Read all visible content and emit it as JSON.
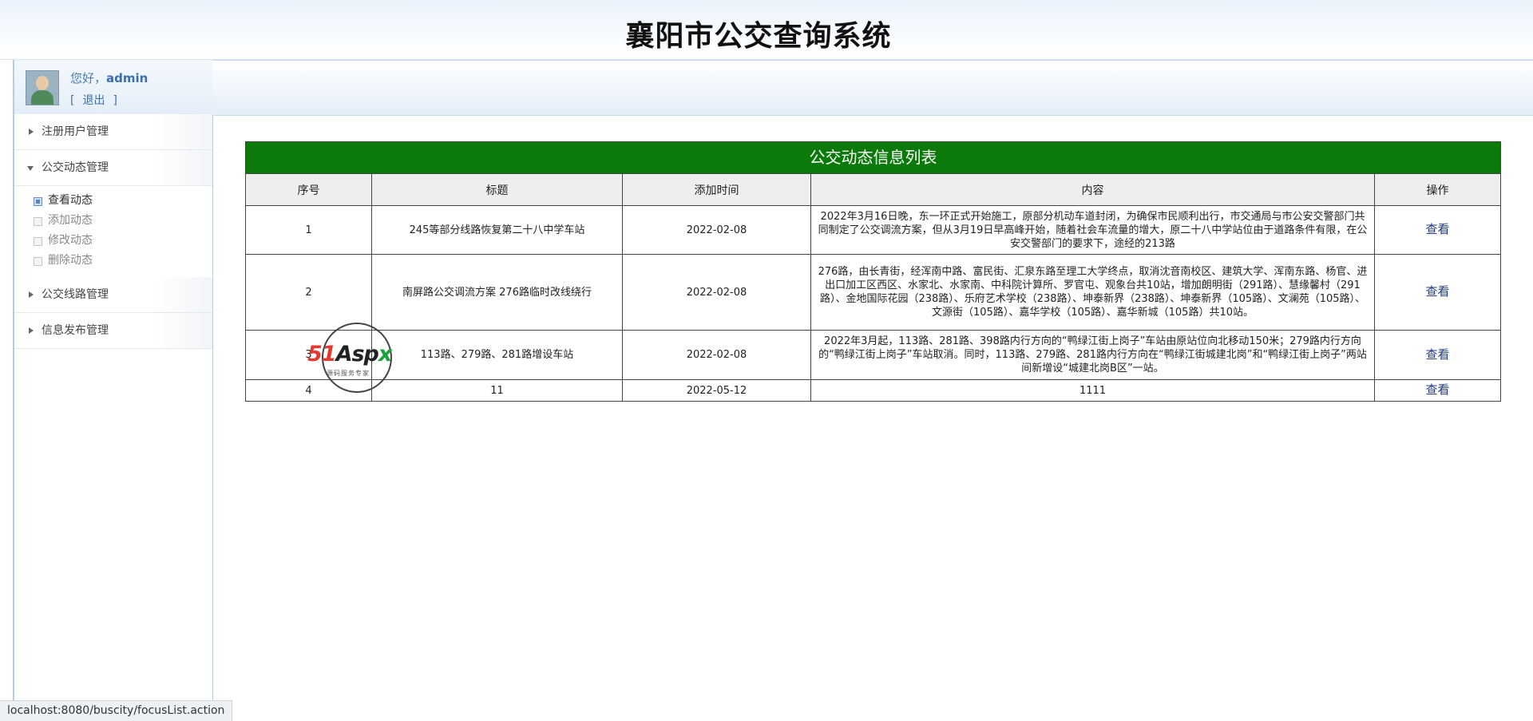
{
  "header": {
    "title": "襄阳市公交查询系统"
  },
  "user": {
    "greeting": "您好，",
    "name": "admin",
    "bracket_left": "[",
    "logout": "退出",
    "bracket_right": "]"
  },
  "menu": {
    "groups": [
      {
        "label": "注册用户管理"
      },
      {
        "label": "公交动态管理",
        "items": [
          "查看动态",
          "添加动态",
          "修改动态",
          "删除动态"
        ]
      },
      {
        "label": "公交线路管理"
      },
      {
        "label": "信息发布管理"
      }
    ]
  },
  "table": {
    "caption": "公交动态信息列表",
    "headers": [
      "序号",
      "标题",
      "添加时间",
      "内容",
      "操作"
    ],
    "rows": [
      {
        "no": "1",
        "title": "245等部分线路恢复第二十八中学车站",
        "date": "2022-02-08",
        "content": "2022年3月16日晚，东一环正式开始施工，原部分机动车道封闭，为确保市民顺利出行，市交通局与市公安交警部门共同制定了公交调流方案，但从3月19日早高峰开始，随着社会车流量的增大，原二十八中学站位由于道路条件有限，在公安交警部门的要求下，途经的213路",
        "action": "查看"
      },
      {
        "no": "2",
        "title": "南屏路公交调流方案 276路临时改线绕行",
        "date": "2022-02-08",
        "content": "276路，由长青街，经浑南中路、富民街、汇泉东路至理工大学终点，取消沈音南校区、建筑大学、浑南东路、杨官、进出口加工区西区、水家北、水家南、中科院计算所、罗官屯、观象台共10站，增加朗明街（291路）、慧缘馨村（291路）、金地国际花园（238路）、乐府艺术学校（238路）、坤泰新界（238路）、坤泰新界（105路）、文澜苑（105路）、文源街（105路）、嘉华学校（105路）、嘉华新城（105路）共10站。",
        "action": "查看"
      },
      {
        "no": "3",
        "title": "113路、279路、281路增设车站",
        "date": "2022-02-08",
        "content": "2022年3月起，113路、281路、398路内行方向的“鸭绿江街上岗子”车站由原站位向北移动150米；279路内行方向的“鸭绿江街上岗子”车站取消。同时，113路、279路、281路内行方向在“鸭绿江街城建北岗”和“鸭绿江街上岗子”两站间新增设“城建北岗B区”一站。",
        "action": "查看"
      },
      {
        "no": "4",
        "title": "11",
        "date": "2022-05-12",
        "content": "1111",
        "action": "查看"
      }
    ]
  },
  "watermark": {
    "brand_a": "51",
    "brand_b": "Asp",
    "brand_c": "x",
    "slogan": "源码服务专家"
  },
  "status": {
    "url": "localhost:8080/buscity/focusList.action"
  }
}
